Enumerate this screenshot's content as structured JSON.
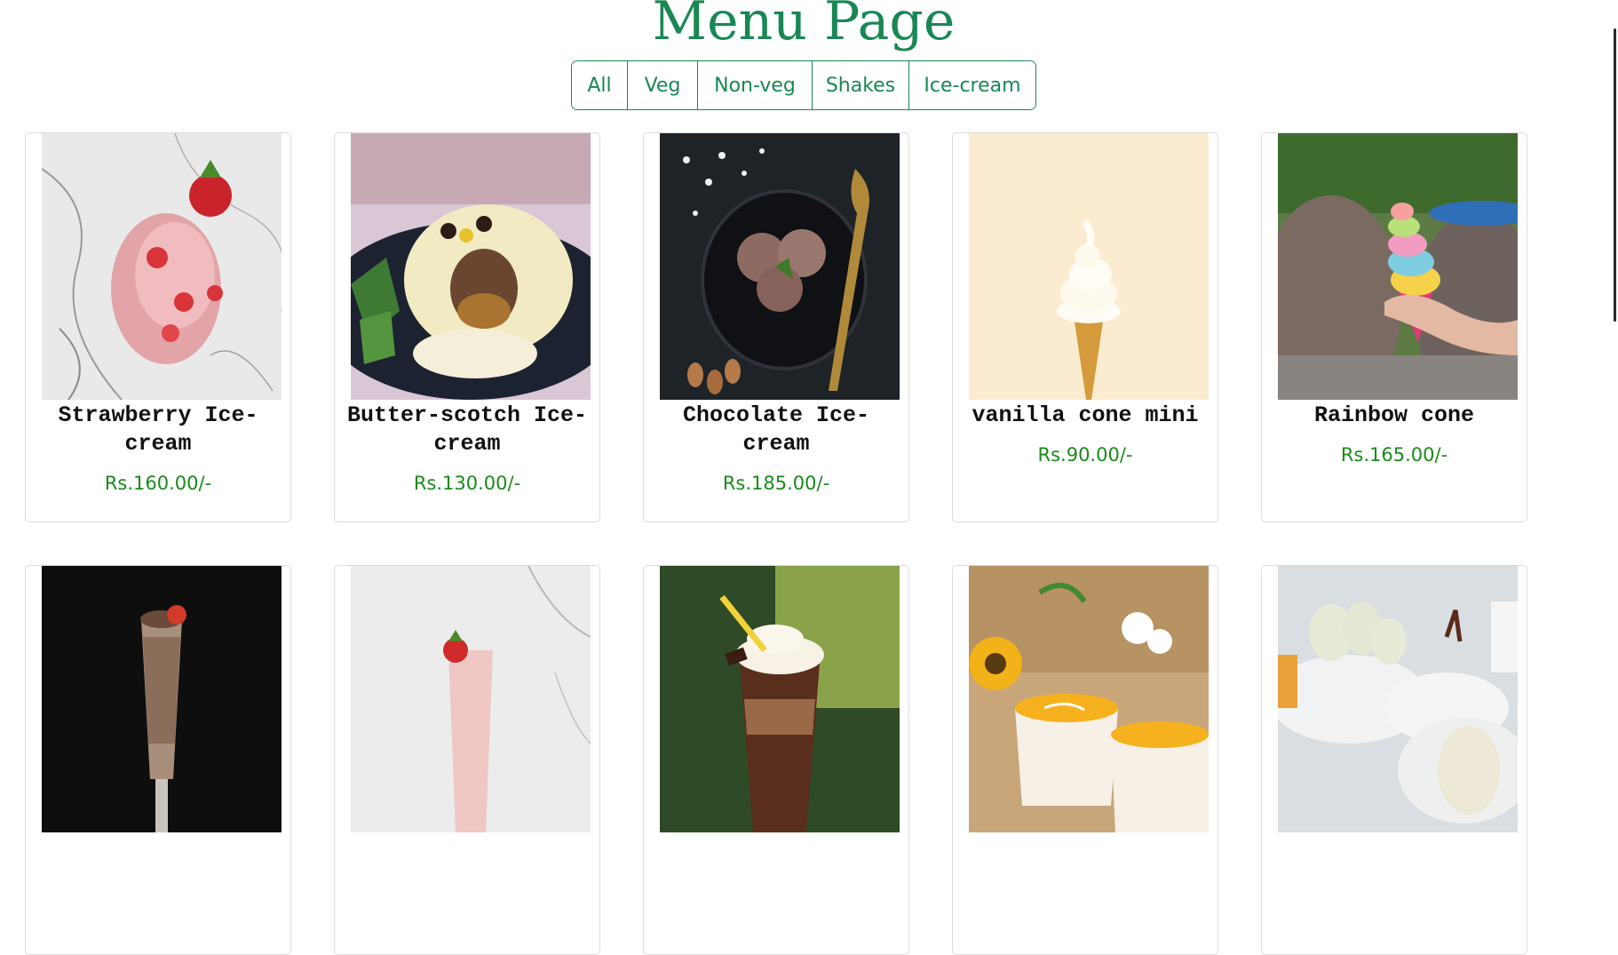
{
  "page": {
    "title": "Menu Page"
  },
  "filters": [
    "All",
    "Veg",
    "Non-veg",
    "Shakes",
    "Ice-cream"
  ],
  "items": [
    {
      "name": "Strawberry Ice-cream",
      "price": "Rs.160.00/-",
      "image": "strawberry-icecream"
    },
    {
      "name": "Butter-scotch Ice-cream",
      "price": "Rs.130.00/-",
      "image": "butterscotch-icecream"
    },
    {
      "name": "Chocolate Ice-cream",
      "price": "Rs.185.00/-",
      "image": "chocolate-icecream"
    },
    {
      "name": "vanilla cone mini",
      "price": "Rs.90.00/-",
      "image": "vanilla-cone"
    },
    {
      "name": "Rainbow cone",
      "price": "Rs.165.00/-",
      "image": "rainbow-cone"
    },
    {
      "name": "",
      "price": "",
      "image": "chocolate-shake"
    },
    {
      "name": "",
      "price": "",
      "image": "strawberry-shake"
    },
    {
      "name": "",
      "price": "",
      "image": "cold-coffee-shake"
    },
    {
      "name": "",
      "price": "",
      "image": "mango-dessert"
    },
    {
      "name": "",
      "price": "",
      "image": "veg-platter"
    }
  ]
}
